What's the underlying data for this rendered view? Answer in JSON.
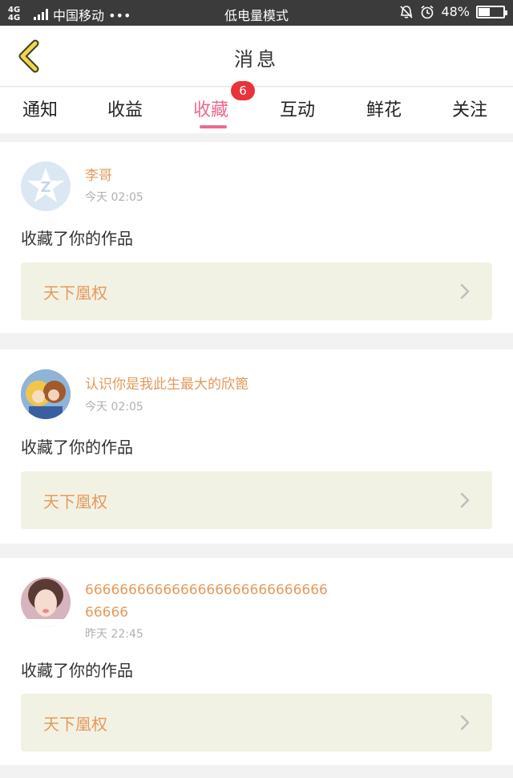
{
  "status_bar": {
    "network": "4G 4G",
    "carrier": "中国移动 •••",
    "mode": "低电量模式",
    "battery_percent": "48%",
    "battery_level": 0.48
  },
  "header": {
    "title": "消息"
  },
  "tabs": [
    {
      "label": "通知"
    },
    {
      "label": "收益"
    },
    {
      "label": "收藏",
      "badge": "6",
      "active": true
    },
    {
      "label": "互动"
    },
    {
      "label": "鲜花"
    },
    {
      "label": "关注"
    }
  ],
  "messages": [
    {
      "user": "李哥",
      "time": "今天 02:05",
      "action": "收藏了你的作品",
      "work": "天下凰权"
    },
    {
      "user": "认识你是我此生最大的欣篦",
      "time": "今天 02:05",
      "action": "收藏了你的作品",
      "work": "天下凰权"
    },
    {
      "user_line1": "6666666666666666666666666666",
      "user_line2": "66666",
      "time": "昨天 22:45",
      "action": "收藏了你的作品",
      "work": "天下凰权"
    }
  ],
  "colors": {
    "accent_pink": "#ec6a8f",
    "name_orange": "#e49a5c",
    "badge_red": "#e8333a",
    "work_bg": "#f2f2e4"
  }
}
